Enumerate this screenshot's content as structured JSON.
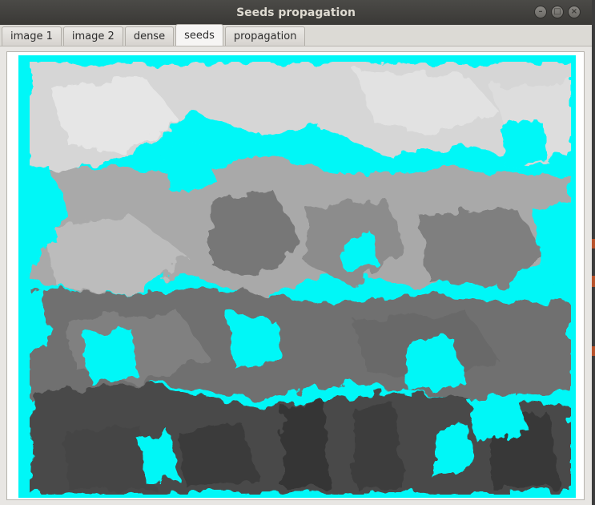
{
  "window": {
    "title": "Seeds propagation",
    "controls": [
      "minimize",
      "maximize",
      "close"
    ]
  },
  "tabs": [
    {
      "label": "image 1",
      "active": false
    },
    {
      "label": "image 2",
      "active": false
    },
    {
      "label": "dense",
      "active": false
    },
    {
      "label": "seeds",
      "active": true
    },
    {
      "label": "propagation",
      "active": false
    }
  ],
  "image": {
    "description_role": "disparity-seeds-map",
    "background_color": "#00f7f7"
  }
}
